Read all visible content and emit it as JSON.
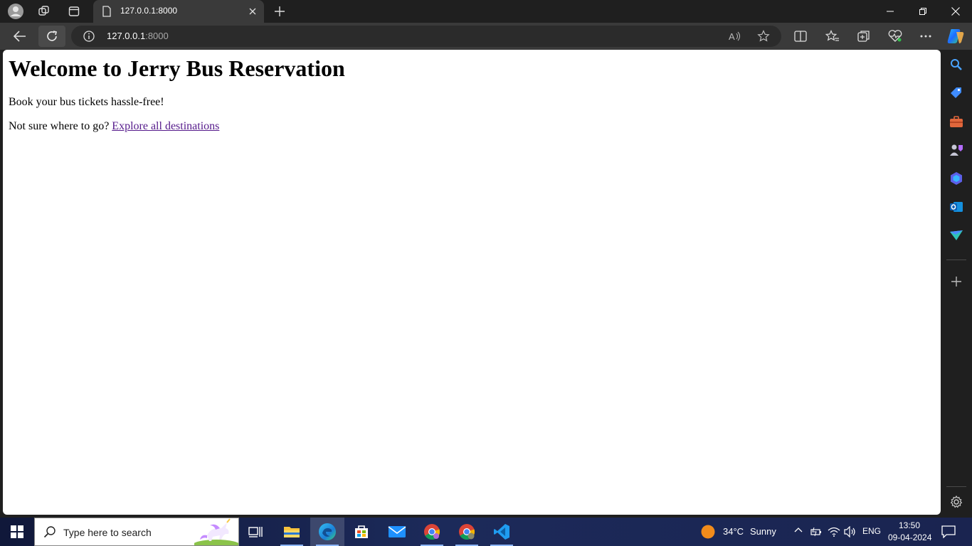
{
  "browser": {
    "tab_title": "127.0.0.1:8000",
    "url_host": "127.0.0.1",
    "url_port": ":8000"
  },
  "page": {
    "heading": "Welcome to Jerry Bus Reservation",
    "tagline": "Book your bus tickets hassle-free!",
    "prompt_text": "Not sure where to go? ",
    "link_text": "Explore all destinations"
  },
  "taskbar": {
    "search_placeholder": "Type here to search",
    "weather_temp": "34°C",
    "weather_desc": "Sunny",
    "language": "ENG",
    "time": "13:50",
    "date": "09-04-2024"
  },
  "colors": {
    "link": "#551a8b",
    "accent": "#0078d4"
  }
}
